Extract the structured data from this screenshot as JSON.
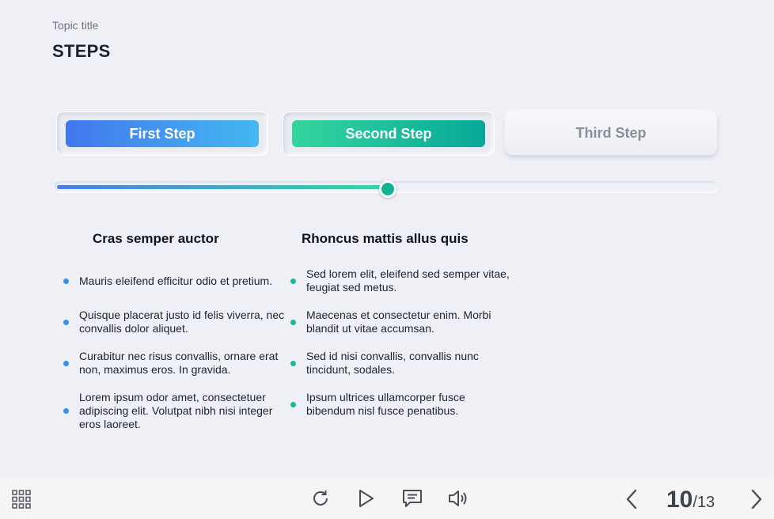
{
  "header": {
    "topic": "Topic title",
    "title": "STEPS"
  },
  "steps": [
    {
      "label": "First Step",
      "state": "done"
    },
    {
      "label": "Second Step",
      "state": "active"
    },
    {
      "label": "Third Step",
      "state": "upcoming"
    }
  ],
  "progress": {
    "fraction": 0.5
  },
  "columns": [
    {
      "heading": "Cras semper auctor",
      "items": [
        "Mauris eleifend efficitur odio et pretium.",
        "Quisque placerat justo id felis viverra, nec convallis dolor aliquet.",
        "Curabitur nec risus convallis, ornare erat non, maximus eros. In gravida.",
        "Lorem ipsum odor amet, consectetuer adipiscing elit. Volutpat nibh nisi integer eros laoreet."
      ]
    },
    {
      "heading": "Rhoncus mattis allus quis",
      "items": [
        "Sed lorem elit, eleifend sed semper vitae, feugiat sed metus.",
        "Maecenas et consectetur enim. Morbi blandit ut vitae accumsan.",
        "Sed id nisi convallis, convallis nunc tincidunt, sodales.",
        "Ipsum ultrices ullamcorper fusce bibendum nisl fusce penatibus."
      ]
    }
  ],
  "footer": {
    "icons": [
      "menu-grid-icon",
      "replay-icon",
      "play-icon",
      "comment-icon",
      "volume-icon",
      "prev-icon",
      "next-icon"
    ],
    "page_current": "10",
    "page_sep": "/",
    "page_total": "13"
  },
  "colors": {
    "background": "#eef0f5",
    "step1_gradient": [
      "#4277ee",
      "#44b8f0"
    ],
    "step2_gradient": [
      "#34d59e",
      "#08a897"
    ],
    "thumb": "#11b395",
    "bullet_col1": "#3d8ee6",
    "bullet_col2": "#1ab898"
  }
}
